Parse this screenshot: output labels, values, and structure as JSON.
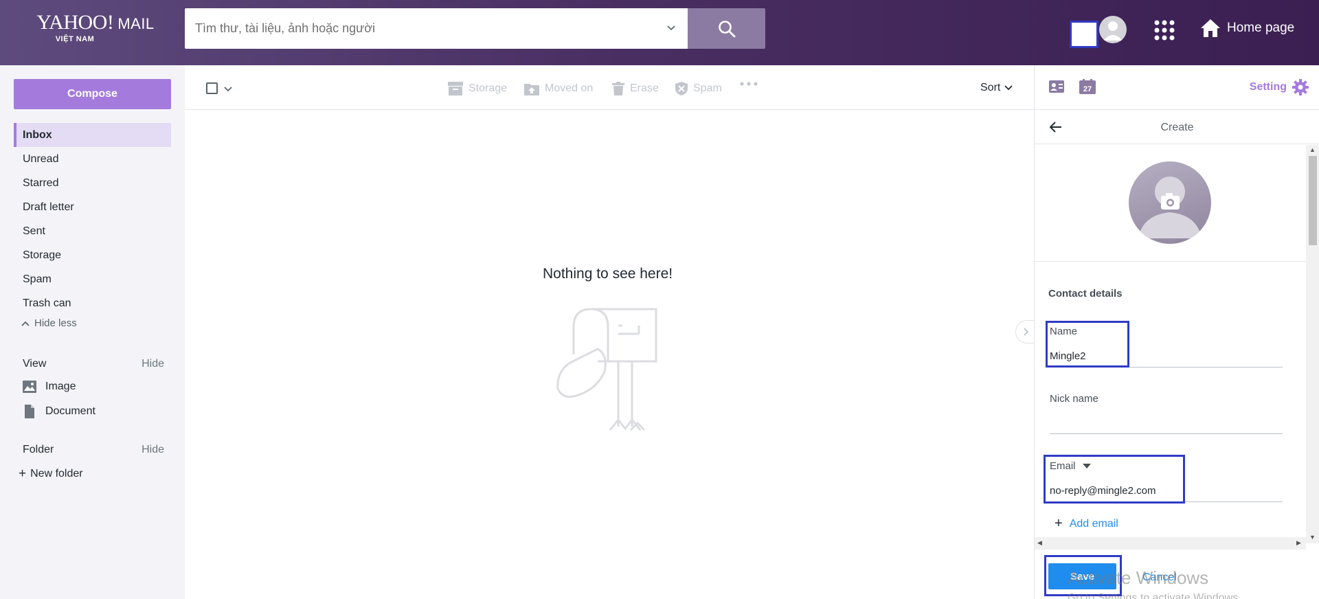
{
  "header": {
    "logo_brand": "YAHOO!",
    "logo_mail": "MAIL",
    "logo_sub": "VIỆT NAM",
    "search_placeholder": "Tìm thư, tài liệu, ảnh hoặc người",
    "home_label": "Home page"
  },
  "sidebar": {
    "compose_label": "Compose",
    "items": [
      {
        "label": "Inbox",
        "active": true
      },
      {
        "label": "Unread"
      },
      {
        "label": "Starred"
      },
      {
        "label": "Draft letter"
      },
      {
        "label": "Sent"
      },
      {
        "label": "Storage"
      },
      {
        "label": "Spam"
      },
      {
        "label": "Trash can"
      }
    ],
    "hide_less_label": "Hide less",
    "view_label": "View",
    "view_hide": "Hide",
    "image_label": "Image",
    "document_label": "Document",
    "folder_label": "Folder",
    "folder_hide": "Hide",
    "new_folder_label": "New folder"
  },
  "toolbar": {
    "storage_label": "Storage",
    "moved_on_label": "Moved on",
    "erase_label": "Erase",
    "spam_label": "Spam",
    "sort_label": "Sort"
  },
  "main": {
    "empty_message": "Nothing to see here!"
  },
  "right_panel": {
    "calendar_day": "27",
    "setting_label": "Setting",
    "create_title": "Create",
    "contact_details_label": "Contact details",
    "name_label": "Name",
    "name_value": "Mingle2",
    "nickname_label": "Nick name",
    "nickname_value": "",
    "email_label": "Email",
    "email_value": "no-reply@mingle2.com",
    "add_email_label": "Add email",
    "save_label": "Save",
    "cancel_label": "Cancel"
  },
  "overlay": {
    "watermark_title": "Activate Windows",
    "watermark_sub": "Go to Settings to activate Windows."
  },
  "colors": {
    "accent": "#a47bdc",
    "link": "#1f8ded",
    "highlight": "#2f3bc4"
  }
}
